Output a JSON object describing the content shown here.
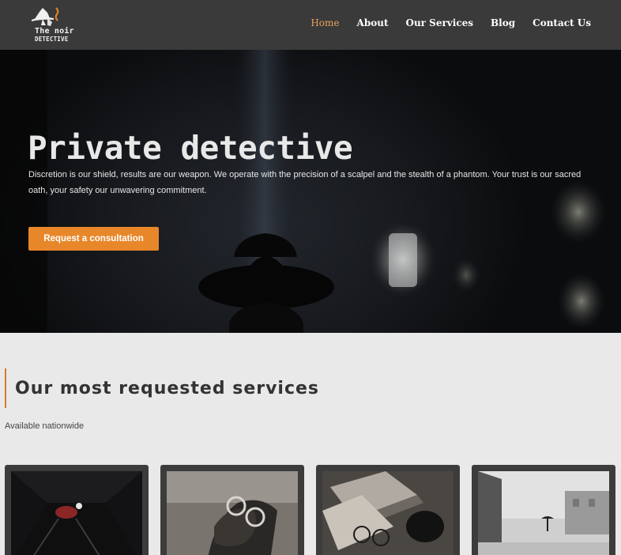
{
  "header": {
    "logo_line1": "The noir",
    "logo_line2": "DETECTIVE",
    "nav": [
      {
        "label": "Home",
        "active": true
      },
      {
        "label": "About"
      },
      {
        "label": "Our Services"
      },
      {
        "label": "Blog"
      },
      {
        "label": "Contact Us"
      }
    ],
    "active_color": "#e8a35a"
  },
  "hero": {
    "title": "Private detective",
    "text": "Discretion is our shield, results are our weapon. We operate with the precision of a scalpel and the stealth of a phantom. Your trust is our sacred oath, your safety our unwavering commitment.",
    "cta_label": "Request a consultation",
    "cta_color": "#e8872a"
  },
  "services": {
    "title": "Our most requested services",
    "subtitle": "Available nationwide",
    "accent_color": "#d97a2a"
  }
}
